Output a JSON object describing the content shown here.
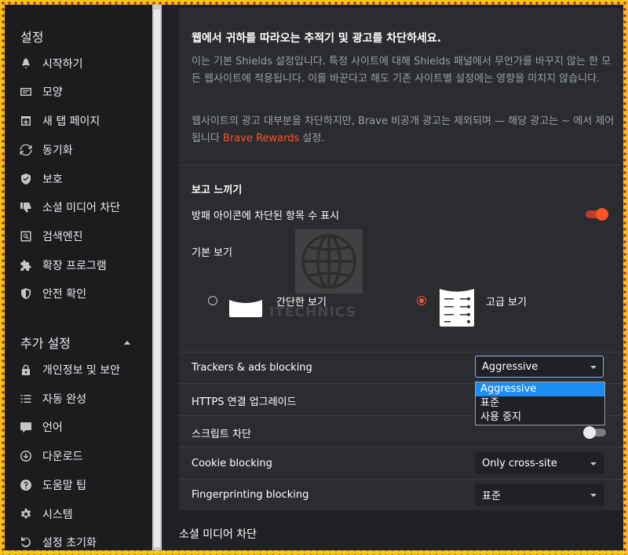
{
  "sidebar": {
    "title": "설정",
    "items": [
      {
        "label": "시작하기",
        "icon": "rocket-icon"
      },
      {
        "label": "모양",
        "icon": "appearance-icon"
      },
      {
        "label": "새 탭 페이지",
        "icon": "new-tab-icon"
      },
      {
        "label": "동기화",
        "icon": "sync-icon"
      },
      {
        "label": "보호",
        "icon": "shield-icon"
      },
      {
        "label": "소셜 미디어 차단",
        "icon": "thumbs-down-icon"
      },
      {
        "label": "검색엔진",
        "icon": "search-icon"
      },
      {
        "label": "확장 프로그램",
        "icon": "puzzle-icon"
      },
      {
        "label": "안전 확인",
        "icon": "safety-shield-icon"
      }
    ],
    "advanced_title": "추가 설정",
    "advanced_items": [
      {
        "label": "개인정보 및 보안",
        "icon": "lock-icon"
      },
      {
        "label": "자동 완성",
        "icon": "list-icon"
      },
      {
        "label": "언어",
        "icon": "language-icon"
      },
      {
        "label": "다운로드",
        "icon": "download-icon"
      },
      {
        "label": "도움말 팁",
        "icon": "help-icon"
      },
      {
        "label": "시스템",
        "icon": "gear-icon"
      },
      {
        "label": "설정 초기화",
        "icon": "reset-icon"
      }
    ]
  },
  "shields": {
    "heading": "웹에서 귀하를 따라오는 추적기 및 광고를 차단하세요.",
    "desc1": "이는 기본 Shields 설정입니다. 특정 사이트에 대해 Shields 패널에서 무언가를 바꾸지 않는 한 모든 웹사이트에 적용됩니다. 이를 바꾼다고 해도 기존 사이트별 설정에는 영향을 미치지 않습니다.",
    "desc2_prefix": "웹사이트의 광고 대부분을 차단하지만, Brave 비공개 광고는 제외되며 — 해당 광고는 ~ 에서 제어됩니다",
    "desc2_link": "Brave Rewards",
    "desc2_suffix": "설정."
  },
  "look": {
    "title": "보고 느끼기",
    "badge_label": "방패 아이콘에 차단된 항목 수 표시",
    "badge_toggle": true,
    "default_view_label": "기본 보기",
    "simple_view": "간단한 보기",
    "advanced_view": "고급 보기",
    "selected_view": "advanced"
  },
  "settings": {
    "trackers_label": "Trackers & ads blocking",
    "trackers_value": "Aggressive",
    "trackers_options": [
      "Aggressive",
      "표준",
      "사용 중지"
    ],
    "https_label": "HTTPS 연결 업그레이드",
    "script_label": "스크립트 차단",
    "script_toggle": false,
    "cookie_label": "Cookie blocking",
    "cookie_value": "Only cross-site",
    "fingerprint_label": "Fingerprinting blocking",
    "fingerprint_value": "표준"
  },
  "footer_section": "소셜 미디어 차단",
  "watermark": "ITECHNICS",
  "colors": {
    "accent": "#fb542b",
    "highlight": "#1e8cf5",
    "background": "#202124"
  }
}
